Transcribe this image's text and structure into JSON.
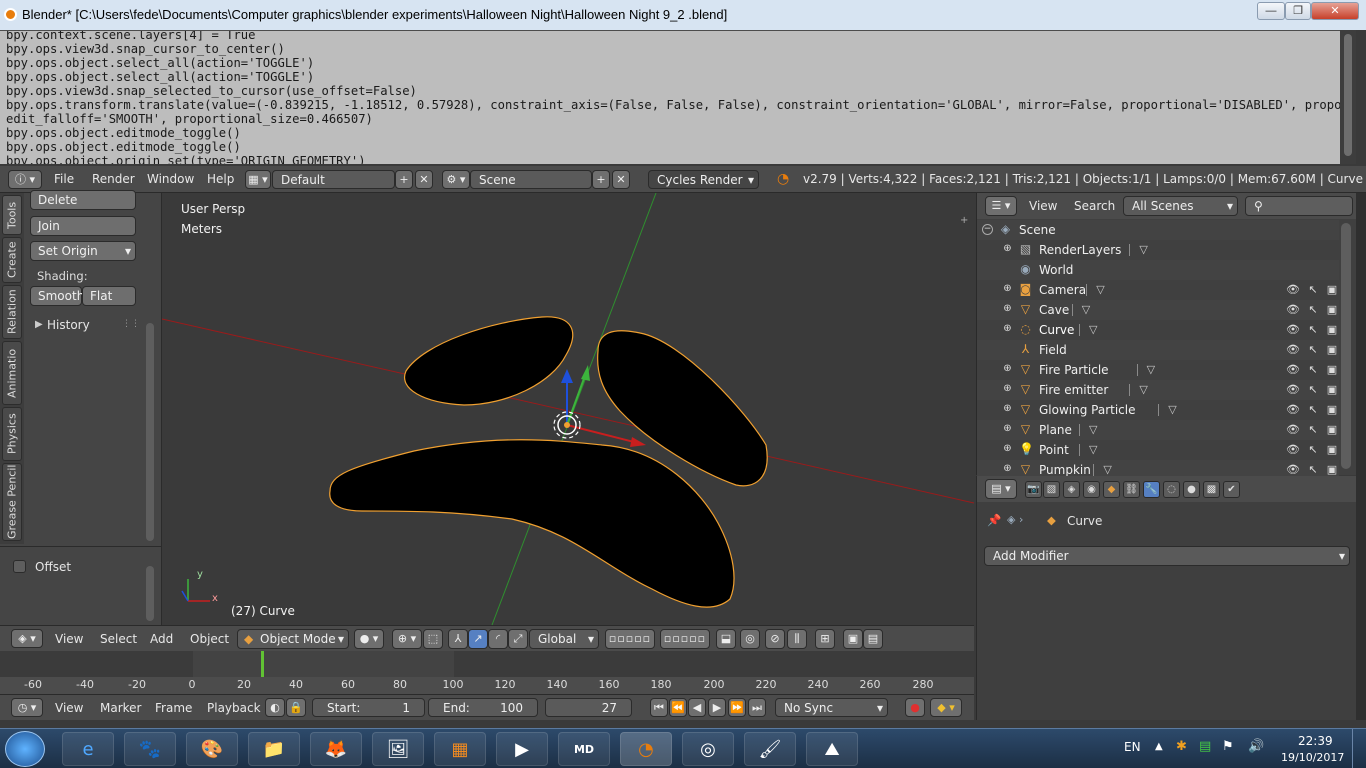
{
  "window": {
    "title": "Blender* [C:\\Users\\fede\\Documents\\Computer graphics\\blender experiments\\Halloween Night\\Halloween Night 9_2 .blend]",
    "minimize_glyph": "—",
    "restore_glyph": "❐",
    "close_glyph": "✕"
  },
  "console": {
    "lines": [
      "bpy.context.scene.layers[4] = True",
      "bpy.ops.view3d.snap_cursor_to_center()",
      "bpy.ops.object.select_all(action='TOGGLE')",
      "bpy.ops.object.select_all(action='TOGGLE')",
      "bpy.ops.view3d.snap_selected_to_cursor(use_offset=False)",
      "bpy.ops.transform.translate(value=(-0.839215, -1.18512, 0.57928), constraint_axis=(False, False, False), constraint_orientation='GLOBAL', mirror=False, proportional='DISABLED', proportional_",
      "edit_falloff='SMOOTH', proportional_size=0.466507)",
      "bpy.ops.object.editmode_toggle()",
      "bpy.ops.object.editmode_toggle()",
      "bpy.ops.object.origin_set(type='ORIGIN_GEOMETRY')"
    ]
  },
  "header": {
    "menus": [
      "File",
      "Render",
      "Window",
      "Help"
    ],
    "screen": "Default",
    "scene": "Scene",
    "engine": "Cycles Render",
    "stats": "v2.79 | Verts:4,322 | Faces:2,121 | Tris:2,121 | Objects:1/1 | Lamps:0/0 | Mem:67.60M | Curve"
  },
  "toolshelf": {
    "tabs": [
      "Tools",
      "Create",
      "Relation",
      "Animatio",
      "Physics",
      "Grease Pencil"
    ],
    "delete": "Delete",
    "join": "Join",
    "set_origin": "Set Origin",
    "shading_label": "Shading:",
    "smooth": "Smooth",
    "flat": "Flat",
    "history": "History",
    "offset": "Offset"
  },
  "viewport": {
    "view_name": "User Persp",
    "units": "Meters",
    "object_label": "(27) Curve",
    "axis_y": "y",
    "axis_x": "x"
  },
  "viewheader": {
    "menus": [
      "View",
      "Select",
      "Add",
      "Object"
    ],
    "mode": "Object Mode",
    "orientation": "Global"
  },
  "timeline": {
    "ticks": [
      "-60",
      "-40",
      "-20",
      "0",
      "20",
      "40",
      "60",
      "80",
      "100",
      "120",
      "140",
      "160",
      "180",
      "200",
      "220",
      "240",
      "260",
      "280"
    ],
    "menus": [
      "View",
      "Marker",
      "Frame",
      "Playback"
    ],
    "start_label": "Start:",
    "start": "1",
    "end_label": "End:",
    "end": "100",
    "current": "27",
    "sync": "No Sync"
  },
  "outliner": {
    "menus": [
      "View",
      "Search"
    ],
    "scene_filter": "All Scenes",
    "scene": "Scene",
    "items": [
      {
        "name": "RenderLayers",
        "icon": "renderlayers-icon"
      },
      {
        "name": "World",
        "icon": "world-icon"
      },
      {
        "name": "Camera",
        "icon": "camera-icon"
      },
      {
        "name": "Cave",
        "icon": "mesh-icon"
      },
      {
        "name": "Curve",
        "icon": "curve-icon"
      },
      {
        "name": "Field",
        "icon": "empty-icon"
      },
      {
        "name": "Fire Particle",
        "icon": "mesh-icon"
      },
      {
        "name": "Fire emitter",
        "icon": "mesh-icon"
      },
      {
        "name": "Glowing Particle",
        "icon": "mesh-icon"
      },
      {
        "name": "Plane",
        "icon": "mesh-icon"
      },
      {
        "name": "Point",
        "icon": "lamp-icon"
      },
      {
        "name": "Pumpkin",
        "icon": "mesh-icon"
      }
    ]
  },
  "properties": {
    "object_name": "Curve",
    "add_modifier": "Add Modifier"
  },
  "taskbar": {
    "lang": "EN",
    "time": "22:39",
    "date": "19/10/2017",
    "md_label": "MD"
  },
  "colors": {
    "accent": "#e87d0d",
    "selection_outline": "#f0a030",
    "x_axis": "#c81e1e",
    "y_axis": "#3cb43c",
    "z_axis": "#1e50dc"
  }
}
